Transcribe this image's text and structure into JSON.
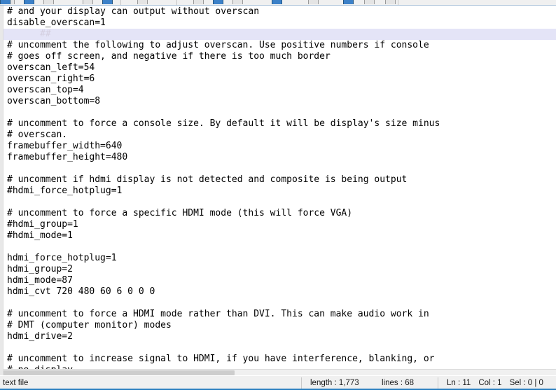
{
  "app": {
    "name": "notepad-plus-plus",
    "accent_color": "#2a7fc0",
    "current_line_highlight": "#e4e4f7",
    "text_color": "#000000",
    "background": "#ffffff"
  },
  "toolbar": {
    "visible_fragment": true,
    "icon_count": 11
  },
  "editor": {
    "current_line_index": 2,
    "ghost_glyph": "##",
    "lines": [
      "# and your display can output without overscan",
      "disable_overscan=1",
      "",
      "# uncomment the following to adjust overscan. Use positive numbers if console",
      "# goes off screen, and negative if there is too much border",
      "overscan_left=54",
      "overscan_right=6",
      "overscan_top=4",
      "overscan_bottom=8",
      "",
      "# uncomment to force a console size. By default it will be display's size minus",
      "# overscan.",
      "framebuffer_width=640",
      "framebuffer_height=480",
      "",
      "# uncomment if hdmi display is not detected and composite is being output",
      "#hdmi_force_hotplug=1",
      "",
      "# uncomment to force a specific HDMI mode (this will force VGA)",
      "#hdmi_group=1",
      "#hdmi_mode=1",
      "",
      "hdmi_force_hotplug=1",
      "hdmi_group=2",
      "hdmi_mode=87",
      "hdmi_cvt 720 480 60 6 0 0 0",
      "",
      "# uncomment to force a HDMI mode rather than DVI. This can make audio work in",
      "# DMT (computer monitor) modes",
      "hdmi_drive=2",
      "",
      "# uncomment to increase signal to HDMI, if you have interference, blanking, or",
      "# no_display"
    ]
  },
  "statusbar": {
    "doc_type": "text file",
    "length_label": "length : 1,773",
    "lines_label": "lines : 68",
    "ln_label": "Ln : 11",
    "col_label": "Col : 1",
    "sel_label": "Sel : 0 | 0"
  }
}
